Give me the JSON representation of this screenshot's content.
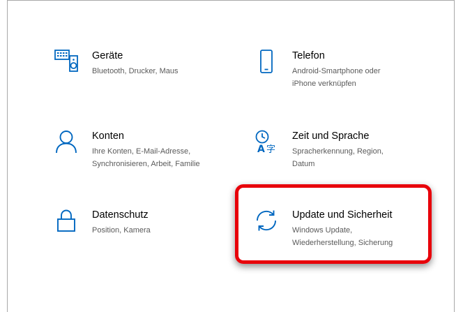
{
  "settings": {
    "items": [
      {
        "id": "geraete",
        "icon": "devices-icon",
        "title": "Geräte",
        "desc_lines": [
          "Bluetooth, Drucker, Maus"
        ]
      },
      {
        "id": "telefon",
        "icon": "phone-icon",
        "title": "Telefon",
        "desc_lines": [
          "Android-Smartphone oder",
          "iPhone verknüpfen"
        ]
      },
      {
        "id": "konten",
        "icon": "person-icon",
        "title": "Konten",
        "desc_lines": [
          "Ihre Konten, E-Mail-Adresse,",
          "Synchronisieren, Arbeit, Familie"
        ]
      },
      {
        "id": "zeit",
        "icon": "time-language-icon",
        "title": "Zeit und Sprache",
        "desc_lines": [
          "Spracherkennung, Region,",
          "Datum"
        ]
      },
      {
        "id": "datenschutz",
        "icon": "lock-icon",
        "title": "Datenschutz",
        "desc_lines": [
          "Position, Kamera"
        ]
      },
      {
        "id": "update",
        "icon": "sync-icon",
        "title": "Update und Sicherheit",
        "desc_lines": [
          "Windows Update,",
          "Wiederherstellung, Sicherung"
        ]
      }
    ]
  },
  "colors": {
    "accent": "#0067c0",
    "highlight": "#e8000a"
  }
}
